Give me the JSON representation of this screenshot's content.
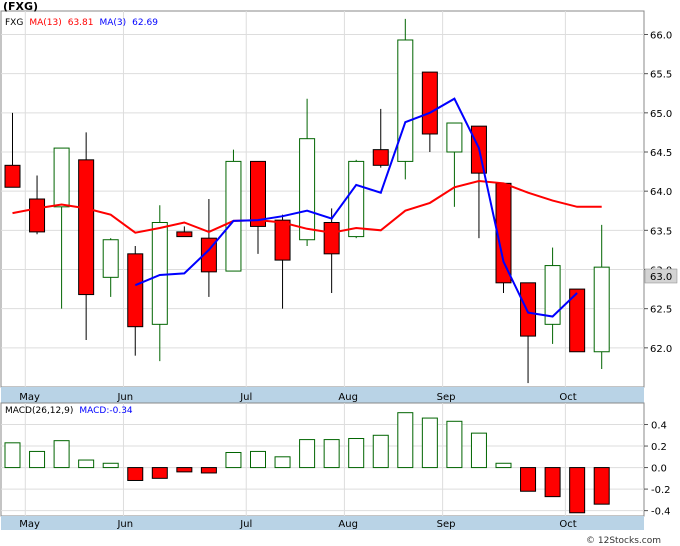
{
  "header": {
    "ticker_label": "(FXG)",
    "legend_main": [
      {
        "text": "FXG",
        "color": "#000000"
      },
      {
        "text": "MA(13)",
        "color": "#ff0000"
      },
      {
        "text": "63.81",
        "color": "#ff0000"
      },
      {
        "text": "MA(3)",
        "color": "#0000ff"
      },
      {
        "text": "62.69",
        "color": "#0000ff"
      }
    ],
    "legend_macd": [
      {
        "text": "MACD(26,12,9)",
        "color": "#000000"
      },
      {
        "text": "MACD:-0.34",
        "color": "#0000ff"
      }
    ],
    "last_price_tag": "63.0",
    "watermark": "© 12Stocks.com"
  },
  "colors": {
    "up_outline": "#006400",
    "down_fill": "#ff0000",
    "ma13": "#ff0000",
    "ma3": "#0000ff",
    "axis_band": "#b9d3e6",
    "last_tag_bg": "#d3d3d3"
  },
  "chart_data": [
    {
      "type": "candlestick",
      "title": "FXG",
      "xlabel": "",
      "ylabel": "",
      "ylim": [
        61.5,
        66.3
      ],
      "yticks": [
        "62.0",
        "62.5",
        "63.0",
        "63.5",
        "64.0",
        "64.5",
        "65.0",
        "65.5",
        "66.0"
      ],
      "grid": true,
      "months": [
        {
          "label": "May",
          "index": 1
        },
        {
          "label": "Jun",
          "index": 5
        },
        {
          "label": "Jul",
          "index": 10
        },
        {
          "label": "Aug",
          "index": 14
        },
        {
          "label": "Sep",
          "index": 18
        },
        {
          "label": "Oct",
          "index": 23
        }
      ],
      "series": [
        {
          "name": "FXG",
          "kind": "ohlc",
          "values": [
            {
              "o": 64.33,
              "h": 65.0,
              "l": 64.05,
              "c": 64.05
            },
            {
              "o": 63.9,
              "h": 64.2,
              "l": 63.45,
              "c": 63.48
            },
            {
              "o": 63.8,
              "h": 64.55,
              "l": 62.5,
              "c": 64.55
            },
            {
              "o": 64.4,
              "h": 64.75,
              "l": 62.1,
              "c": 62.68
            },
            {
              "o": 62.9,
              "h": 63.4,
              "l": 62.65,
              "c": 63.38
            },
            {
              "o": 63.2,
              "h": 63.3,
              "l": 61.9,
              "c": 62.27
            },
            {
              "o": 62.3,
              "h": 63.82,
              "l": 61.83,
              "c": 63.6
            },
            {
              "o": 63.48,
              "h": 63.55,
              "l": 63.42,
              "c": 63.42
            },
            {
              "o": 63.4,
              "h": 63.9,
              "l": 62.65,
              "c": 62.97
            },
            {
              "o": 62.98,
              "h": 64.53,
              "l": 62.98,
              "c": 64.38
            },
            {
              "o": 64.38,
              "h": 64.38,
              "l": 63.2,
              "c": 63.55
            },
            {
              "o": 63.63,
              "h": 63.7,
              "l": 62.5,
              "c": 63.12
            },
            {
              "o": 63.38,
              "h": 65.18,
              "l": 63.3,
              "c": 64.67
            },
            {
              "o": 63.6,
              "h": 63.78,
              "l": 62.7,
              "c": 63.2
            },
            {
              "o": 63.42,
              "h": 64.4,
              "l": 63.4,
              "c": 64.38
            },
            {
              "o": 64.53,
              "h": 65.05,
              "l": 64.3,
              "c": 64.33
            },
            {
              "o": 64.38,
              "h": 66.2,
              "l": 64.15,
              "c": 65.93
            },
            {
              "o": 65.52,
              "h": 65.52,
              "l": 64.5,
              "c": 64.73
            },
            {
              "o": 64.5,
              "h": 64.87,
              "l": 63.8,
              "c": 64.87
            },
            {
              "o": 64.83,
              "h": 64.83,
              "l": 63.4,
              "c": 64.23
            },
            {
              "o": 64.1,
              "h": 64.1,
              "l": 62.7,
              "c": 62.83
            },
            {
              "o": 62.83,
              "h": 62.83,
              "l": 61.55,
              "c": 62.15
            },
            {
              "o": 62.3,
              "h": 63.28,
              "l": 62.05,
              "c": 63.05
            },
            {
              "o": 62.75,
              "h": 62.75,
              "l": 61.95,
              "c": 61.95
            },
            {
              "o": 61.95,
              "h": 63.57,
              "l": 61.73,
              "c": 63.03
            }
          ]
        },
        {
          "name": "MA(13)",
          "kind": "line",
          "start_index": 0,
          "values": [
            63.72,
            63.78,
            63.83,
            63.78,
            63.7,
            63.47,
            63.53,
            63.6,
            63.48,
            63.62,
            63.63,
            63.6,
            63.52,
            63.47,
            63.53,
            63.5,
            63.75,
            63.85,
            64.05,
            64.13,
            64.1,
            63.98,
            63.88,
            63.8,
            63.8
          ]
        },
        {
          "name": "MA(3)",
          "kind": "line",
          "start_index": 5,
          "values": [
            62.8,
            62.93,
            62.95,
            63.25,
            63.62,
            63.63,
            63.68,
            63.75,
            63.65,
            64.08,
            63.98,
            64.88,
            65.0,
            65.18,
            64.55,
            63.1,
            62.45,
            62.4,
            62.7
          ]
        }
      ]
    },
    {
      "type": "bar",
      "title": "MACD(26,12,9)",
      "xlabel": "",
      "ylabel": "",
      "ylim": [
        -0.45,
        0.6
      ],
      "yticks": [
        "-0.4",
        "-0.2",
        "0.0",
        "0.2",
        "0.4"
      ],
      "grid": true,
      "series": [
        {
          "name": "MACD",
          "values": [
            0.23,
            0.15,
            0.25,
            0.07,
            0.04,
            -0.12,
            -0.1,
            -0.04,
            -0.05,
            0.14,
            0.15,
            0.1,
            0.26,
            0.26,
            0.27,
            0.3,
            0.51,
            0.46,
            0.43,
            0.32,
            0.04,
            -0.22,
            -0.27,
            -0.42,
            -0.34
          ]
        }
      ]
    }
  ]
}
